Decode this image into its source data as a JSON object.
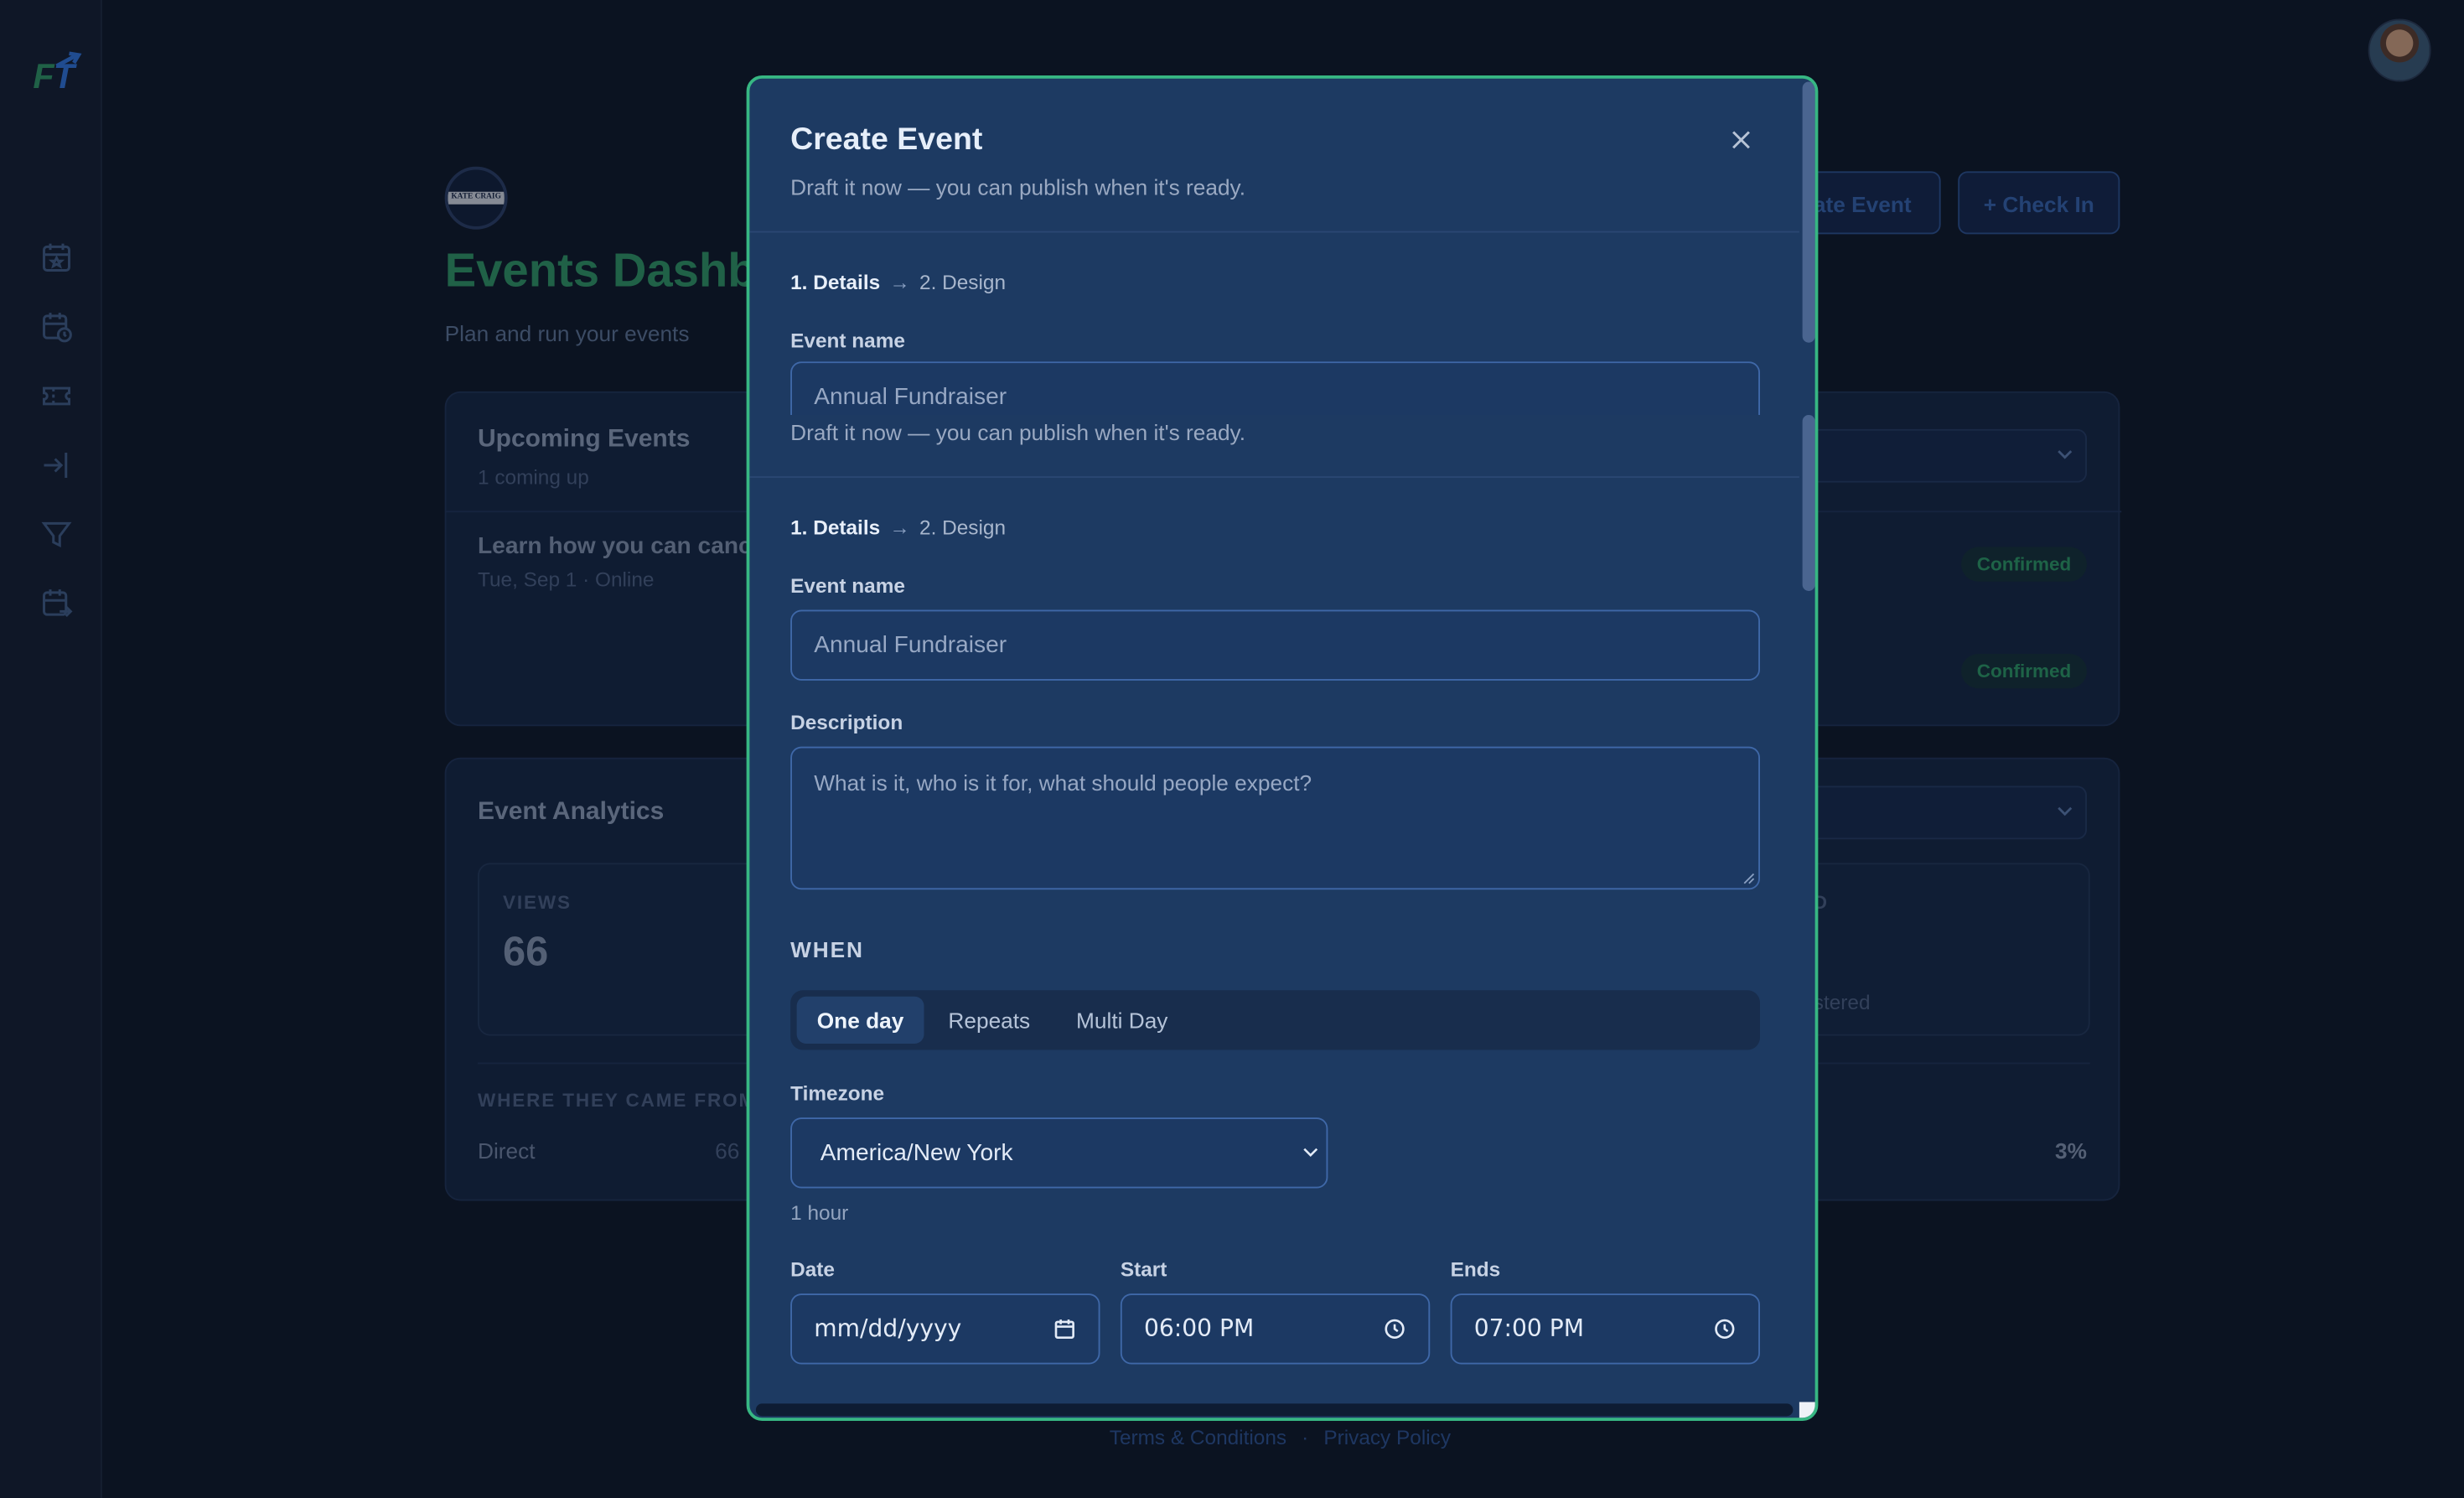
{
  "sidebar": {
    "logo_text": "FT",
    "nav_icons": [
      "calendar-star-icon",
      "calendar-clock-icon",
      "ticket-icon",
      "sign-in-icon",
      "filter-icon",
      "calendar-arrow-icon"
    ]
  },
  "header": {
    "brand_badge_text": "KATE CRAIG",
    "title": "Events Dashboard",
    "subtitle": "Plan and run your events",
    "create_event_button": "+ Create Event",
    "check_in_button": "+ Check In"
  },
  "upcoming": {
    "title": "Upcoming Events",
    "count": "1 coming up",
    "event_title": "Learn how you can cancel",
    "event_meta": "Tue, Sep 1 · Online",
    "statuses": [
      "Confirmed",
      "Confirmed"
    ]
  },
  "analytics": {
    "title": "Event Analytics",
    "views_label": "VIEWS",
    "views_value": "66",
    "right_stat_label": "D",
    "right_stat_sub": "stered",
    "sources_heading": "WHERE THEY CAME FROM",
    "source_name": "Direct",
    "source_count": "66",
    "source_pct": "3%"
  },
  "footer": {
    "terms": "Terms & Conditions",
    "separator": "·",
    "privacy": "Privacy Policy"
  },
  "modal": {
    "title": "Create Event",
    "subtitle": "Draft it now — you can publish when it's ready.",
    "step1": "1. Details",
    "step2": "2. Design",
    "event_name_label": "Event name",
    "event_name_placeholder": "Annual Fundraiser",
    "description_label": "Description",
    "description_placeholder": "What is it, who is it for, what should people expect?",
    "when_heading": "WHEN",
    "when_tabs": [
      "One day",
      "Repeats",
      "Multi Day"
    ],
    "when_active": "One day",
    "timezone_label": "Timezone",
    "timezone_value": "America/New York",
    "duration_hint": "1 hour",
    "date_label": "Date",
    "date_value": "mm/dd/yyyy",
    "start_label": "Start",
    "start_value": "06:00 PM",
    "ends_label": "Ends",
    "ends_value": "07:00 PM"
  },
  "colors": {
    "accent_green": "#37b783",
    "modal_bg": "#1d3a62",
    "page_bg": "#0f1727",
    "brand_title": "#2e8f62"
  }
}
